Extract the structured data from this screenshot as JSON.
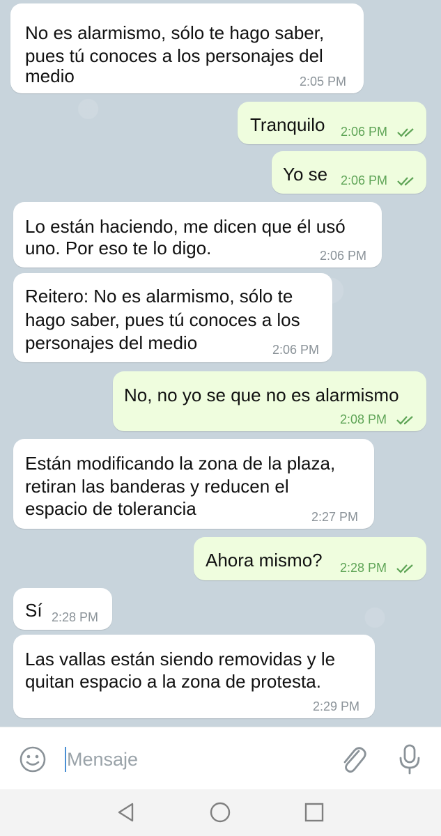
{
  "messages": [
    {
      "direction": "in",
      "lines": [
        "No es alarmismo, sólo te hago saber,",
        "pues tú conoces a los personajes del",
        "medio"
      ],
      "time": "2:05 PM"
    },
    {
      "direction": "out",
      "lines": [
        "Tranquilo"
      ],
      "time": "2:06 PM",
      "read": true
    },
    {
      "direction": "out",
      "lines": [
        "Yo se"
      ],
      "time": "2:06 PM",
      "read": true
    },
    {
      "direction": "in",
      "lines": [
        "Lo están haciendo, me dicen que él usó",
        "uno. Por eso te lo digo."
      ],
      "time": "2:06 PM"
    },
    {
      "direction": "in",
      "lines": [
        "Reitero: No es alarmismo, sólo te",
        "hago saber, pues tú conoces a los",
        "personajes del medio"
      ],
      "time": "2:06 PM"
    },
    {
      "direction": "out",
      "lines": [
        "No, no yo se que no es alarmismo"
      ],
      "time": "2:08 PM",
      "read": true
    },
    {
      "direction": "in",
      "lines": [
        "Están modificando la zona de la plaza,",
        "retiran las banderas y reducen el",
        "espacio de tolerancia"
      ],
      "time": "2:27 PM"
    },
    {
      "direction": "out",
      "lines": [
        "Ahora mismo?"
      ],
      "time": "2:28 PM",
      "read": true
    },
    {
      "direction": "in",
      "lines": [
        "Sí"
      ],
      "time": "2:28 PM"
    },
    {
      "direction": "in",
      "lines": [
        "Las vallas están siendo removidas y le",
        "quitan espacio a la zona de protesta."
      ],
      "time": "2:29 PM"
    }
  ],
  "composer": {
    "placeholder": "Mensaje",
    "emoji_icon": "emoji-icon",
    "attach_icon": "paperclip-icon",
    "mic_icon": "microphone-icon"
  },
  "nav": {
    "back_icon": "back-triangle-icon",
    "home_icon": "home-circle-icon",
    "recents_icon": "recents-square-icon"
  },
  "colors": {
    "incoming_bubble": "#ffffff",
    "outgoing_bubble": "#effdde",
    "outgoing_time": "#5ea456",
    "read_check": "#5ea456",
    "incoming_time": "#8a9298",
    "chat_background": "#c8d4dc"
  }
}
